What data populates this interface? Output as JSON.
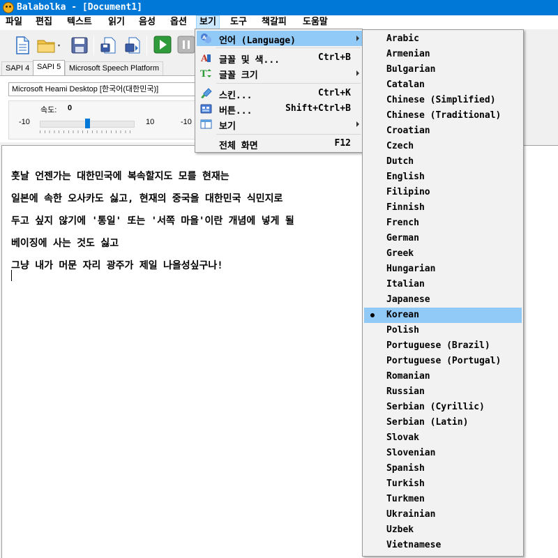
{
  "window": {
    "title": "Balabolka - [Document1]"
  },
  "menubar": [
    "파일",
    "편집",
    "텍스트",
    "읽기",
    "음성",
    "옵션",
    "보기",
    "도구",
    "책갈피",
    "도움말"
  ],
  "tabs": [
    "SAPI 4",
    "SAPI 5",
    "Microsoft Speech Platform"
  ],
  "voice": {
    "selected": "Microsoft Heami Desktop [한국어(대한민국)]"
  },
  "rate": {
    "label": "속도:",
    "value": "0",
    "min": "-10",
    "max": "10",
    "next_min": "-10",
    "level": 0.5
  },
  "view_menu": {
    "language": "언어 (Language)",
    "font_color": "글꼴 및 색...",
    "font_color_shortcut": "Ctrl+B",
    "font_size": "글꼴 크기",
    "skin": "스킨...",
    "skin_shortcut": "Ctrl+K",
    "buttons": "버튼...",
    "buttons_shortcut": "Shift+Ctrl+B",
    "view": "보기",
    "fullscreen": "전체 화면",
    "fullscreen_shortcut": "F12"
  },
  "languages": [
    "Arabic",
    "Armenian",
    "Bulgarian",
    "Catalan",
    "Chinese (Simplified)",
    "Chinese (Traditional)",
    "Croatian",
    "Czech",
    "Dutch",
    "English",
    "Filipino",
    "Finnish",
    "French",
    "German",
    "Greek",
    "Hungarian",
    "Italian",
    "Japanese",
    "Korean",
    "Polish",
    "Portuguese (Brazil)",
    "Portuguese (Portugal)",
    "Romanian",
    "Russian",
    "Serbian (Cyrillic)",
    "Serbian (Latin)",
    "Slovak",
    "Slovenian",
    "Spanish",
    "Turkish",
    "Turkmen",
    "Ukrainian",
    "Uzbek",
    "Vietnamese"
  ],
  "selected_language": "Korean",
  "document": {
    "lines": [
      "훗날 언젠가는 대한민국에 복속할지도 모를 현재는",
      "일본에 속한 오사카도 싫고, 현재의 중국을 대한민국 식민지로",
      "두고 싶지 않기에 '통일' 또는 '서쪽 마을'이란 개념에 넣게 될",
      "베이징에 사는 것도 싫고",
      "그냥 내가 머문 자리 광주가 제일 나을성싶구나!"
    ]
  },
  "icons": [
    "app-icon",
    "new-document-icon",
    "open-folder-icon",
    "save-icon",
    "export-icon",
    "play-icon",
    "pause-icon"
  ]
}
